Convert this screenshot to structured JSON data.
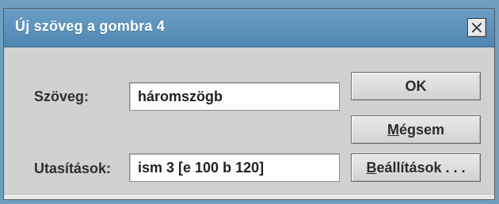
{
  "window": {
    "title": "Új szöveg a gombra 4"
  },
  "fields": {
    "text_label": "Szöveg:",
    "text_value": "háromszögb",
    "commands_label": "Utasítások:",
    "commands_value": "ism 3 [e 100 b 120]"
  },
  "buttons": {
    "ok": "OK",
    "cancel_mnemonic": "M",
    "cancel_rest": "égsem",
    "settings_mnemonic": "B",
    "settings_rest": "eállítások . . ."
  },
  "icons": {
    "close": "close-icon"
  }
}
